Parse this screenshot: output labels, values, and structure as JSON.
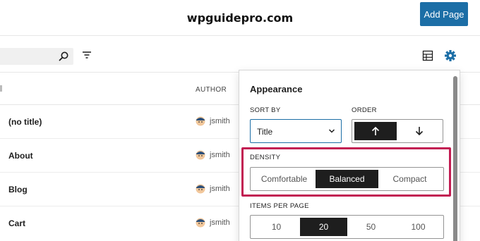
{
  "header": {
    "watermark": "wpguidepro.com",
    "add_page_label": "Add Page"
  },
  "table": {
    "author_column": "AUTHOR",
    "rows": [
      {
        "title": "(no title)",
        "author": "jsmith"
      },
      {
        "title": "About",
        "author": "jsmith"
      },
      {
        "title": "Blog",
        "author": "jsmith"
      },
      {
        "title": "Cart",
        "author": "jsmith"
      }
    ]
  },
  "panel": {
    "heading": "Appearance",
    "sort_by_label": "SORT BY",
    "sort_by_value": "Title",
    "order_label": "ORDER",
    "order_options": [
      "ascending",
      "descending"
    ],
    "order_selected": "ascending",
    "density_label": "DENSITY",
    "density_options": [
      "Comfortable",
      "Balanced",
      "Compact"
    ],
    "density_selected": "Balanced",
    "items_per_page_label": "ITEMS PER PAGE",
    "items_per_page_options": [
      "10",
      "20",
      "50",
      "100"
    ],
    "items_per_page_selected": "20"
  },
  "colors": {
    "accent": "#1c6ea6",
    "highlight": "#c21c52",
    "selected_bg": "#1e1e1e"
  },
  "icons": [
    "search-icon",
    "filter-icon",
    "table-view-icon",
    "settings-icon",
    "chevron-down-icon",
    "arrow-up-icon",
    "arrow-down-icon",
    "avatar"
  ]
}
